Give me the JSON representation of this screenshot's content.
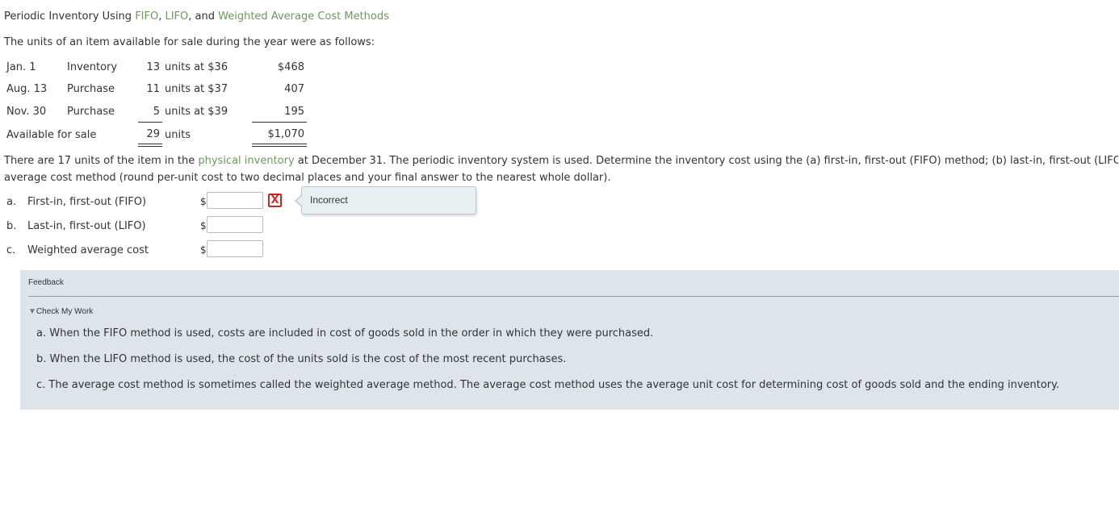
{
  "header": {
    "title_prefix": "Periodic Inventory Using ",
    "title_fifo": "FIFO",
    "title_sep1": ", ",
    "title_lifo": "LIFO",
    "title_sep2": ", and ",
    "title_wac": "Weighted Average Cost Methods"
  },
  "intro": "The units of an item available for sale during the year were as follows:",
  "inventory_rows": [
    {
      "date": "Jan. 1",
      "type": "Inventory",
      "units": "13",
      "unit_text": "units at $36",
      "cost": "$468"
    },
    {
      "date": "Aug. 13",
      "type": "Purchase",
      "units": "11",
      "unit_text": "units at $37",
      "cost": "407"
    },
    {
      "date": "Nov. 30",
      "type": "Purchase",
      "units": "5",
      "unit_text": "units at $39",
      "cost": "195"
    }
  ],
  "total_row": {
    "label": "Available for sale",
    "units": "29",
    "unit_text": "units",
    "cost": "$1,070"
  },
  "question": {
    "part1": "There are 17 units of the item in the ",
    "link": "physical inventory",
    "part2": " at December 31. The periodic inventory system is used. Determine the inventory cost using the (a) first-in, first-out (FIFO) method; (b) last-in, first-out (LIFO) method; and (c) the weighted",
    "line2": "average cost method (round per-unit cost to two decimal places and your final answer to the nearest whole dollar)."
  },
  "answers": [
    {
      "letter": "a.",
      "label": "First-in, first-out (FIFO)",
      "currency": "$",
      "value": "",
      "status": "incorrect"
    },
    {
      "letter": "b.",
      "label": "Last-in, first-out (LIFO)",
      "currency": "$",
      "value": ""
    },
    {
      "letter": "c.",
      "label": "Weighted average cost",
      "currency": "$",
      "value": ""
    }
  ],
  "incorrect_mark": "X",
  "tooltip": "Incorrect",
  "feedback": {
    "heading": "Feedback",
    "toggle_arrow": "▼",
    "toggle_label": "Check My Work",
    "items": [
      "a. When the FIFO method is used, costs are included in cost of goods sold in the order in which they were purchased.",
      "b. When the LIFO method is used, the cost of the units sold is the cost of the most recent purchases.",
      "c. The average cost method is sometimes called the weighted average method. The average cost method uses the average unit cost for determining cost of goods sold and the ending inventory."
    ]
  },
  "colors": {
    "link_green": "#6c9a5e",
    "error_red": "#d32f2f",
    "feedback_bg": "#dde5ea"
  }
}
